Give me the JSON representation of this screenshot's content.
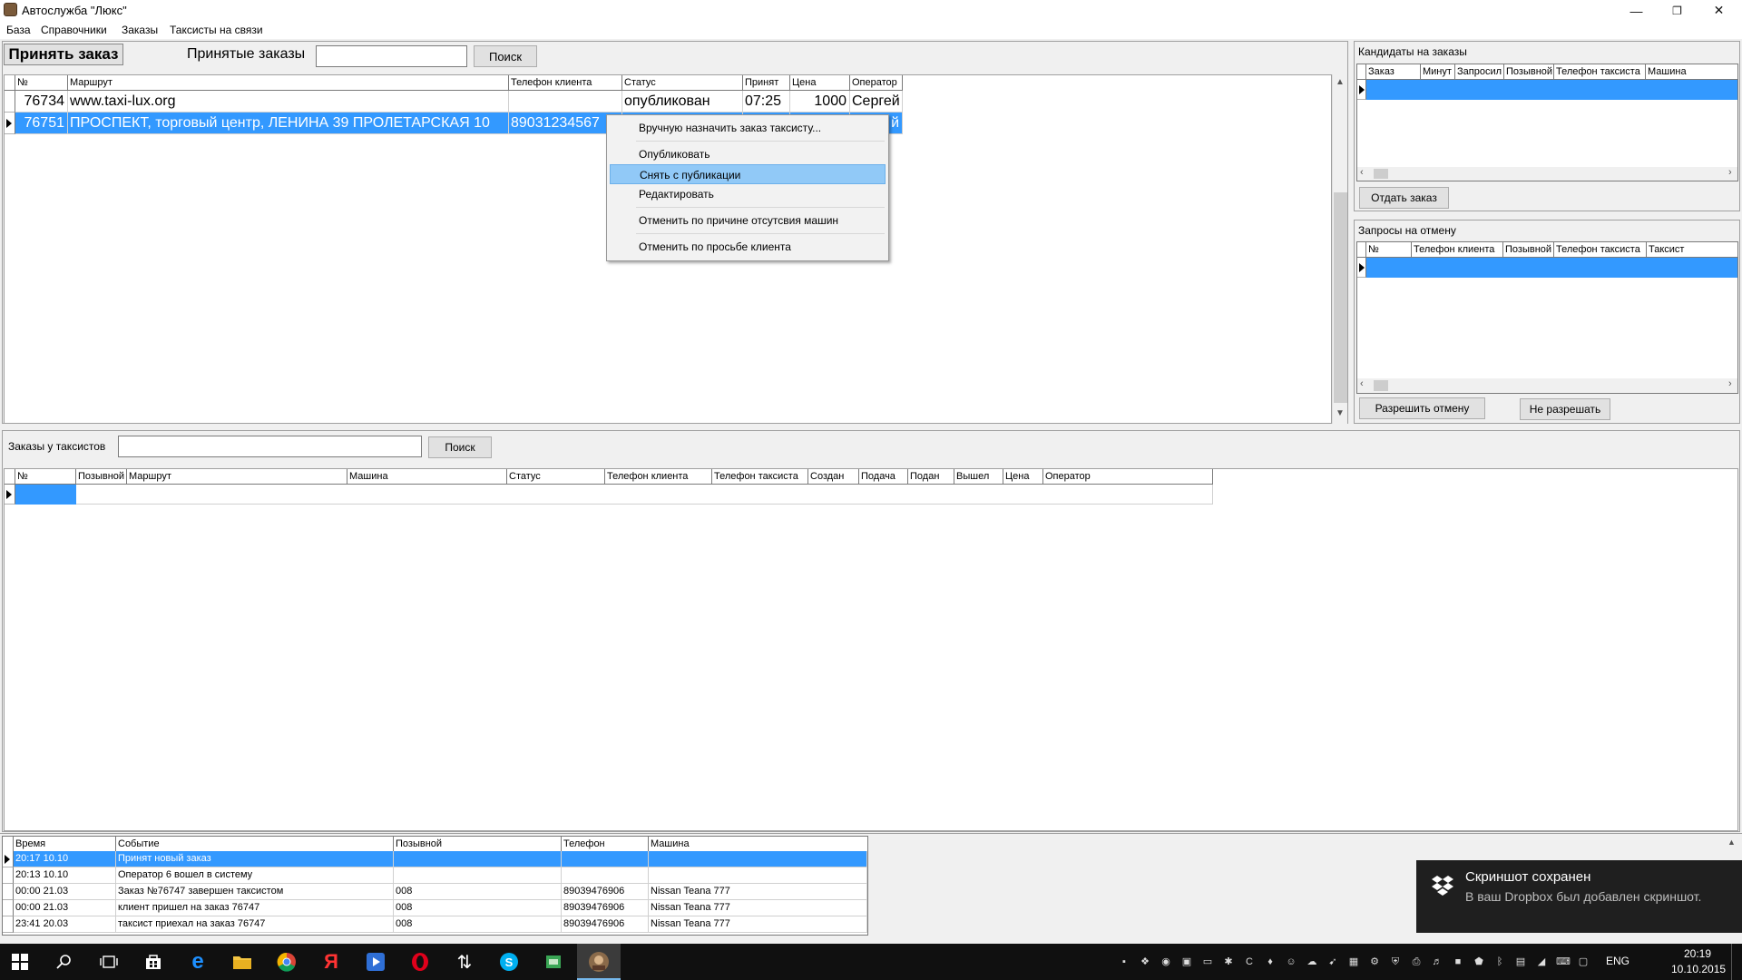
{
  "window": {
    "title": "Автослужба \"Люкс\"",
    "minimize": "—",
    "restore": "❐",
    "close": "✕"
  },
  "menu": [
    "База",
    "Справочники",
    "Заказы",
    "Таксисты на связи"
  ],
  "accepted": {
    "accept_button": "Принять заказ",
    "label": "Принятые заказы",
    "search_value": "",
    "search_button": "Поиск",
    "columns": [
      "№",
      "Маршрут",
      "Телефон клиента",
      "Статус",
      "Принят",
      "Цена",
      "Оператор"
    ],
    "rows": [
      {
        "num": "76734",
        "route": "www.taxi-lux.org",
        "phone": "",
        "status": "опубликован",
        "time": "07:25",
        "price": "1000",
        "operator": "Сергей"
      },
      {
        "num": "76751",
        "route": "ПРОСПЕКТ, торговый центр, ЛЕНИНА 39 ПРОЛЕТАРСКАЯ 10",
        "phone": "89031234567",
        "status": "",
        "time": "",
        "price": "",
        "operator": "й"
      }
    ]
  },
  "context_menu": {
    "items": [
      "Вручную назначить заказ таксисту...",
      "Опубликовать",
      "Снять с публикации",
      "Редактировать",
      "Отменить по причине отсутсвия машин",
      "Отменить по просьбе клиента"
    ],
    "highlighted": "Снять с публикации"
  },
  "candidates": {
    "title": "Кандидаты на заказы",
    "columns": [
      "Заказ",
      "Минут",
      "Запросил",
      "Позывной",
      "Телефон таксиста",
      "Машина"
    ],
    "give_button": "Отдать заказ"
  },
  "cancel_requests": {
    "title": "Запросы на отмену",
    "columns": [
      "№",
      "Телефон клиента",
      "Позывной",
      "Телефон таксиста",
      "Таксист"
    ],
    "allow_button": "Разрешить отмену",
    "deny_button": "Не разрешать"
  },
  "driver_orders": {
    "label": "Заказы у таксистов",
    "search_value": "",
    "search_button": "Поиск",
    "columns": [
      "№",
      "Позывной",
      "Маршрут",
      "Машина",
      "Статус",
      "Телефон клиента",
      "Телефон таксиста",
      "Создан",
      "Подача",
      "Подан",
      "Вышел",
      "Цена",
      "Оператор"
    ]
  },
  "events": {
    "columns": [
      "Время",
      "Событие",
      "Позывной",
      "Телефон",
      "Машина"
    ],
    "rows": [
      {
        "time": "20:17 10.10",
        "event": "Принят новый заказ",
        "callsign": "",
        "phone": "",
        "car": ""
      },
      {
        "time": "20:13 10.10",
        "event": "Оператор 6 вошел в систему",
        "callsign": "",
        "phone": "",
        "car": ""
      },
      {
        "time": "00:00 21.03",
        "event": "Заказ №76747 завершен таксистом",
        "callsign": "008",
        "phone": "89039476906",
        "car": "Nissan Teana 777"
      },
      {
        "time": "00:00 21.03",
        "event": "клиент пришел на заказ 76747",
        "callsign": "008",
        "phone": "89039476906",
        "car": "Nissan Teana 777"
      },
      {
        "time": "23:41 20.03",
        "event": "таксист приехал на заказ 76747",
        "callsign": "008",
        "phone": "89039476906",
        "car": "Nissan Teana 777"
      }
    ]
  },
  "toast": {
    "title": "Скриншот сохранен",
    "body": "В ваш Dropbox был добавлен скриншот."
  },
  "taskbar": {
    "lang": "ENG",
    "time": "20:19",
    "date": "10.10.2015"
  },
  "colors": {
    "selection": "#3399ff",
    "menu_highlight": "#91c9f7",
    "taskbar": "#101010"
  }
}
